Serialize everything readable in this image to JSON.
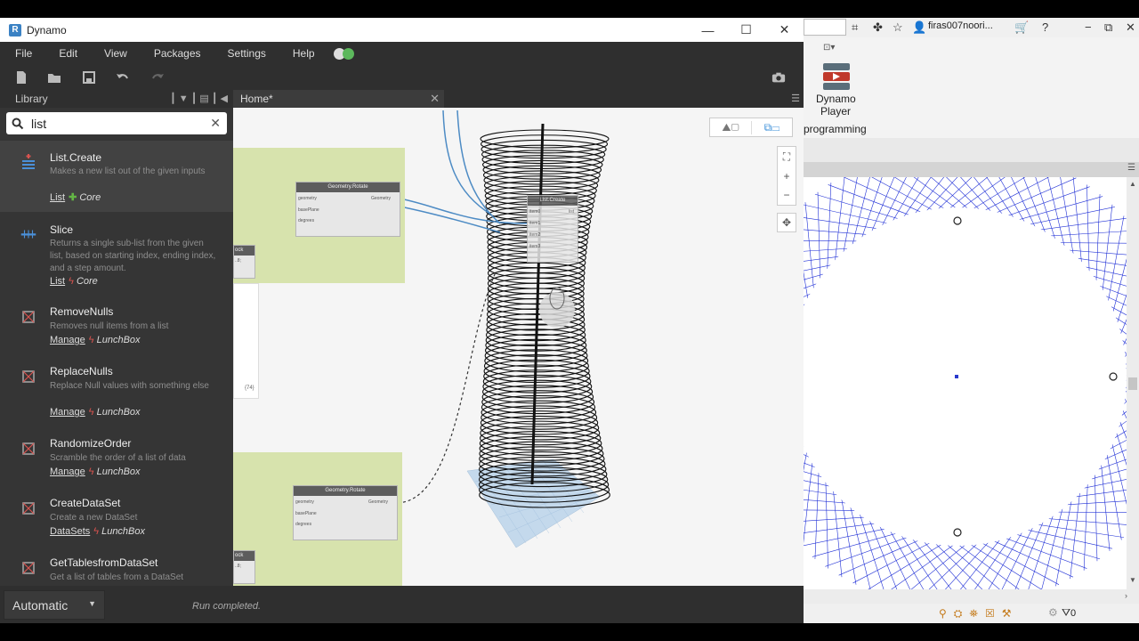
{
  "dynamo": {
    "title": "Dynamo",
    "logo_letter": "R",
    "window_buttons": {
      "minimize": "—",
      "maximize": "☐",
      "close": "✕"
    },
    "menu": [
      "File",
      "Edit",
      "View",
      "Packages",
      "Settings",
      "Help"
    ],
    "library": {
      "header": "Library",
      "search_value": "list",
      "results": [
        {
          "name": "List.Create",
          "description": "Makes a new list out of the given inputs",
          "category": "List",
          "package": "Core",
          "pkg_type": "core"
        },
        {
          "name": "Slice",
          "description": "Returns a single sub-list from the given list, based on starting index, ending index, and a step amount.",
          "category": "List",
          "package": "Core",
          "pkg_type": "core"
        },
        {
          "name": "RemoveNulls",
          "description": "Removes null items from a list",
          "category": "Manage",
          "package": "LunchBox",
          "pkg_type": "custom"
        },
        {
          "name": "ReplaceNulls",
          "description": "Replace Null values with something else",
          "category": "Manage",
          "package": "LunchBox",
          "pkg_type": "custom"
        },
        {
          "name": "RandomizeOrder",
          "description": "Scramble the order of a list of data",
          "category": "Manage",
          "package": "LunchBox",
          "pkg_type": "custom"
        },
        {
          "name": "CreateDataSet",
          "description": "Create a new DataSet",
          "category": "DataSets",
          "package": "LunchBox",
          "pkg_type": "custom"
        },
        {
          "name": "GetTablesfromDataSet",
          "description": "Get a list of tables from a DataSet",
          "category": "",
          "package": "",
          "pkg_type": "custom"
        }
      ]
    },
    "workspace": {
      "tab": "Home*",
      "nodes": {
        "rotate_title": "Geometry.Rotate",
        "rotate_inputs": [
          "geometry",
          "basePlane",
          "degrees"
        ],
        "rotate_output": "Geometry",
        "list_create_title": "List.Create",
        "list_create_inputs": [
          "item0",
          "item1",
          "item2",
          "item3"
        ],
        "list_create_output": "list",
        "code_block_label": "ock",
        "code_block_value": "..8;",
        "list_count": "{74}"
      }
    },
    "run_mode": "Automatic",
    "run_status": "Run completed."
  },
  "revit": {
    "user": "firas007noori...",
    "player_label": "Dynamo Player",
    "ribbon_group": "programming",
    "status_count": "0"
  }
}
